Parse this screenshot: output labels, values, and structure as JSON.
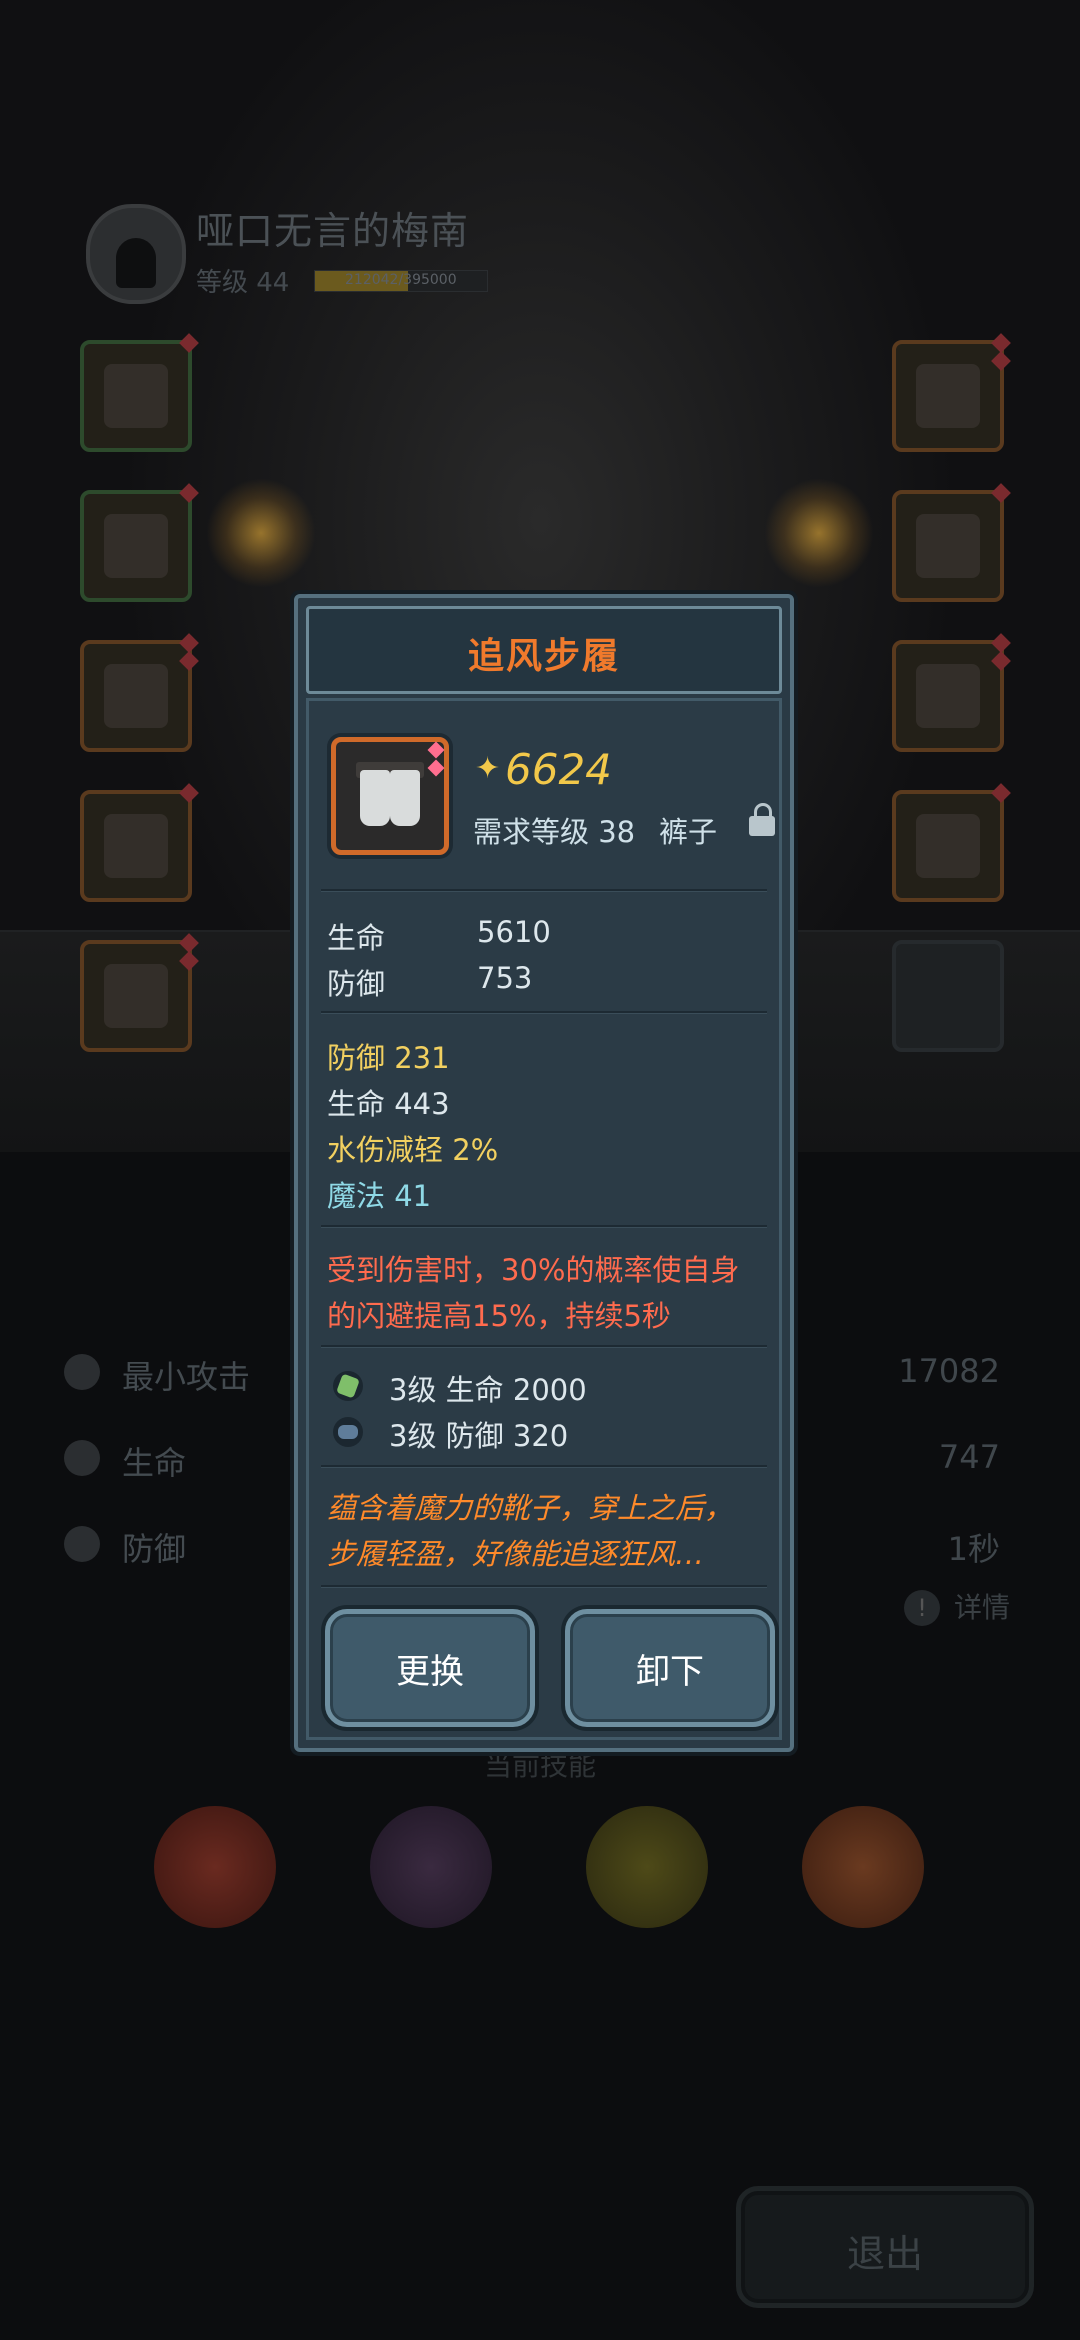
{
  "player": {
    "name": "哑口无言的梅南",
    "level_label": "等级 44",
    "xp_text": "212042/395000",
    "xp_progress": 0.54
  },
  "stats_background": [
    {
      "label": "最小攻击",
      "value": "17082",
      "icon": "sword-icon"
    },
    {
      "label": "生命",
      "value": "747",
      "icon": "heart-icon"
    },
    {
      "label": "防御",
      "value": "1秒",
      "icon": "shield-icon"
    }
  ],
  "detail_label": "详情",
  "skills_title": "当前技能",
  "exit_label": "退出",
  "item": {
    "name": "追风步履",
    "score": "6624",
    "required_level": "需求等级 38",
    "slot_type": "裤子",
    "icon": "boots-icon",
    "base_stats": [
      {
        "label": "生命",
        "value": "5610"
      },
      {
        "label": "防御",
        "value": "753"
      }
    ],
    "bonus_stats": [
      {
        "text": "防御   231",
        "color": "yellow"
      },
      {
        "text": "生命   443",
        "color": "white"
      },
      {
        "text": "水伤减轻   2%",
        "color": "yellow"
      },
      {
        "text": "魔法   41",
        "color": "cyan"
      }
    ],
    "effect": [
      "受到伤害时，30%的概率使自身",
      "的闪避提高15%，持续5秒"
    ],
    "set_bonuses": [
      {
        "text": "3级   生命 2000",
        "gem": "green-gem-icon"
      },
      {
        "text": "3级   防御 320",
        "gem": "blue-gem-icon"
      }
    ],
    "description": [
      "蕴含着魔力的靴子，穿上之后，",
      "步履轻盈，好像能追逐狂风…"
    ],
    "replace_label": "更换",
    "unequip_label": "卸下"
  },
  "colors": {
    "title_orange": "#f07a2c",
    "score_gold": "#f2c84a",
    "effect_red": "#ff6b4e",
    "desc_orange": "#ff8a2a",
    "popup_bg": "#2a3a45"
  }
}
